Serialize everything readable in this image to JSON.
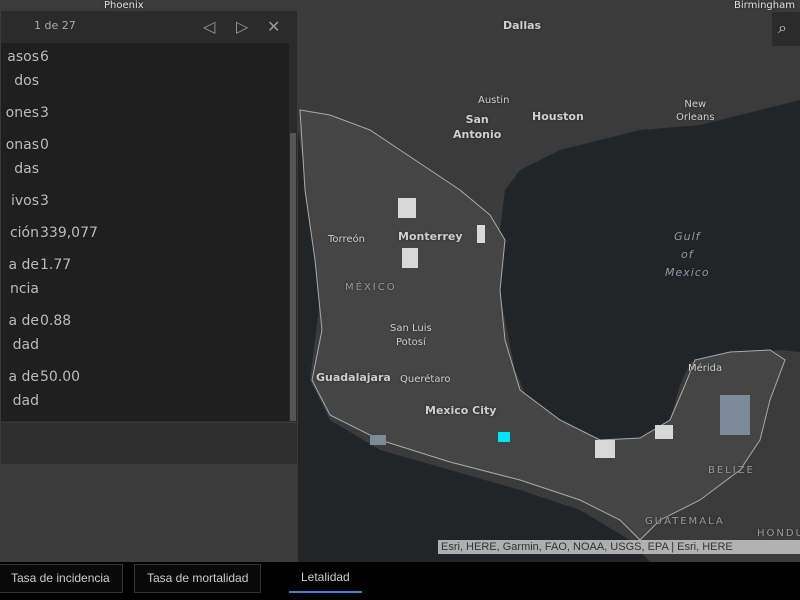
{
  "map": {
    "labels": {
      "phoenix": "Phoenix",
      "dallas": "Dallas",
      "austin": "Austin",
      "san_antonio": "San\nAntonio",
      "houston": "Houston",
      "new_orleans": "New\nOrleans",
      "birmingham": "Birmingham",
      "gulf": "Gulf\nof\nMexico",
      "torreon": "Torreón",
      "monterrey": "Monterrey",
      "mexico": "MÉXICO",
      "slp": "San Luis\nPotosí",
      "guadalajara": "Guadalajara",
      "queretaro": "Querétaro",
      "mexico_city": "Mexico City",
      "merida": "Mérida",
      "belize": "BELIZE",
      "guatemala": "GUATEMALA",
      "honduras": "HONDU"
    },
    "attribution": "Esri, HERE, Garmin, FAO, NOAA, USGS, EPA | Esri, HERE",
    "colors": {
      "land": "#3b3b3b",
      "water": "#222528",
      "highlight": "#00e5ff",
      "light": "#d8d8d8",
      "mid": "#7d8b99"
    }
  },
  "popup": {
    "count": "1 de 27",
    "icons": {
      "prev": "chevron-left-icon",
      "next": "chevron-right-icon",
      "close": "close-icon"
    },
    "rows": [
      {
        "key": "asos\ndos",
        "value": "6"
      },
      {
        "key": "ones",
        "value": "3"
      },
      {
        "key": "onas\ndas",
        "value": "0"
      },
      {
        "key": "ivos",
        "value": "3"
      },
      {
        "key": "ción",
        "value": "339,077"
      },
      {
        "key": "a de\nncia",
        "value": "1.77"
      },
      {
        "key": "a de\ndad",
        "value": "0.88"
      },
      {
        "key": "a de\ndad",
        "value": "50.00"
      }
    ]
  },
  "tabs": [
    {
      "label": "Tasa de incidencia"
    },
    {
      "label": "Tasa de mortalidad"
    },
    {
      "label": "Letalidad",
      "active": true
    }
  ]
}
